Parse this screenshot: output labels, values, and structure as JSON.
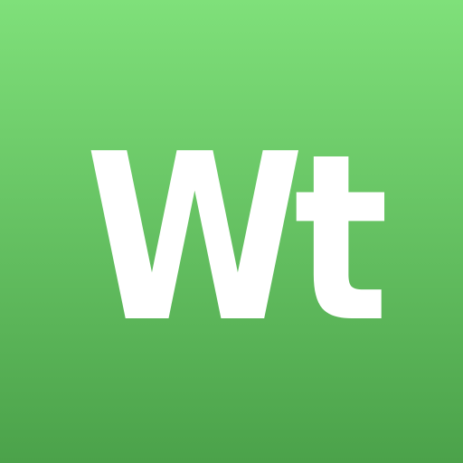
{
  "app_icon": {
    "monogram": "Wt",
    "colors": {
      "gradient_top": "#7fe07a",
      "gradient_bottom": "#4ba24a",
      "glyph": "#ffffff"
    }
  }
}
